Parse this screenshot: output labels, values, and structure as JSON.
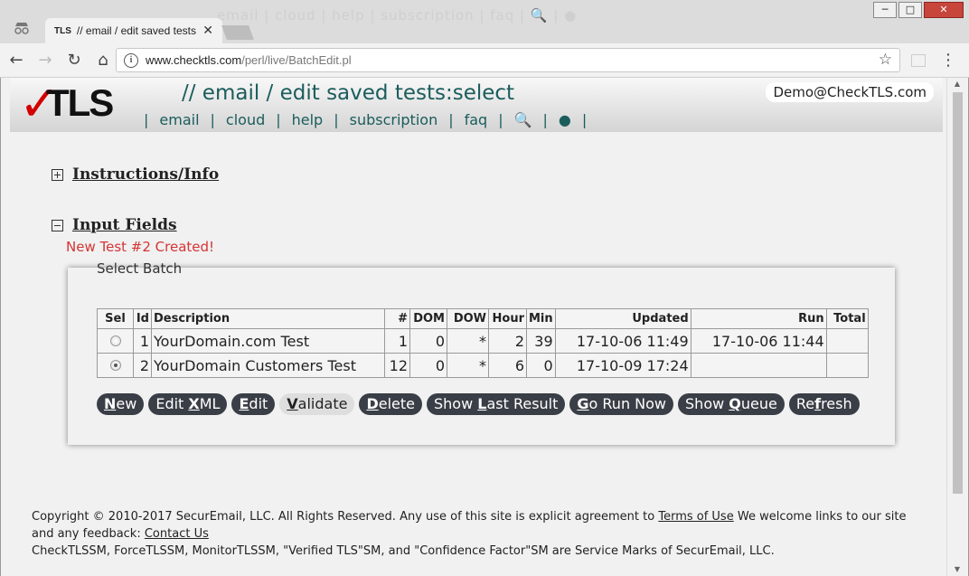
{
  "browser": {
    "tab_title": "// email / edit saved tests",
    "favicon_text": "TLS",
    "url_domain": "www.checktls.com",
    "url_path": "/perl/live/BatchEdit.pl",
    "ghost_menu": "email  |  cloud  |  help  |  subscription  |  faq  |  🔍  |  ●",
    "window_buttons": [
      "─",
      "□",
      "✕"
    ]
  },
  "header": {
    "logo_check": "✓",
    "logo_text": "TLS",
    "title": "// email / edit saved tests:select",
    "account": "Demo@CheckTLS.com",
    "nav": [
      {
        "label": "email"
      },
      {
        "label": "cloud"
      },
      {
        "label": "help"
      },
      {
        "label": "subscription"
      },
      {
        "label": "faq"
      },
      {
        "label": "🔍",
        "icon": "search-icon"
      },
      {
        "label": "●",
        "icon": "globe-icon"
      }
    ]
  },
  "sections": {
    "instructions": "Instructions/Info",
    "input_fields": "Input Fields"
  },
  "message": "New Test #2 Created!",
  "batch": {
    "legend": "Select Batch",
    "columns": [
      "Sel",
      "Id",
      "Description",
      "#",
      "DOM",
      "DOW",
      "Hour",
      "Min",
      "Updated",
      "Run",
      "Total"
    ],
    "rows": [
      {
        "selected": false,
        "id": "1",
        "description": "YourDomain.com Test",
        "num": "1",
        "dom": "0",
        "dow": "*",
        "hour": "2",
        "min": "39",
        "updated": "17-10-06 11:49",
        "run": "17-10-06 11:44",
        "total": ""
      },
      {
        "selected": true,
        "id": "2",
        "description": "YourDomain Customers Test",
        "num": "12",
        "dom": "0",
        "dow": "*",
        "hour": "6",
        "min": "0",
        "updated": "17-10-09 17:24",
        "run": "",
        "total": ""
      }
    ]
  },
  "buttons": [
    {
      "pre": "",
      "key": "N",
      "post": "ew",
      "style": "dark"
    },
    {
      "pre": "Edit ",
      "key": "X",
      "post": "ML",
      "style": "dark"
    },
    {
      "pre": "",
      "key": "E",
      "post": "dit",
      "style": "dark"
    },
    {
      "pre": "",
      "key": "V",
      "post": "alidate",
      "style": "light"
    },
    {
      "pre": "",
      "key": "D",
      "post": "elete",
      "style": "dark"
    },
    {
      "pre": "Show ",
      "key": "L",
      "post": "ast Result",
      "style": "dark"
    },
    {
      "pre": "",
      "key": "G",
      "post": "o Run Now",
      "style": "dark"
    },
    {
      "pre": "Show ",
      "key": "Q",
      "post": "ueue",
      "style": "dark"
    },
    {
      "pre": "Re",
      "key": "f",
      "post": "resh",
      "style": "dark"
    }
  ],
  "footer": {
    "line1_pre": "Copyright © 2010-2017 SecurEmail, LLC. All Rights Reserved. Any use of this site is explicit agreement to ",
    "terms_link": "Terms of Use",
    "line1_post": " We welcome links to our site and any feedback: ",
    "contact_link": "Contact Us",
    "line2": "CheckTLSSM, ForceTLSSM, MonitorTLSSM, \"Verified TLS\"SM, and \"Confidence Factor\"SM are Service Marks of SecurEmail, LLC."
  }
}
